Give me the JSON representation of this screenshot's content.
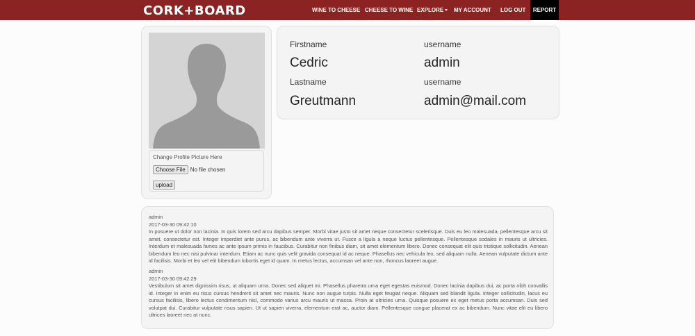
{
  "nav": {
    "brand": "CORK+BOARD",
    "links": [
      {
        "label": "WINE TO CHEESE"
      },
      {
        "label": "CHEESE TO WINE"
      },
      {
        "label": "EXPLORE"
      },
      {
        "label": "MY ACCOUNT"
      },
      {
        "label": "LOG OUT"
      },
      {
        "label": "REPORT"
      }
    ],
    "colors": {
      "bar": "#8a2322",
      "report_bg": "#000000"
    }
  },
  "profile": {
    "avatar_icon": "default-user-silhouette",
    "upload": {
      "hint": "Change Profile Picture Here",
      "choose_label": "Choose File",
      "file_status": "No file chosen",
      "upload_label": "upload"
    }
  },
  "info": {
    "firstname_label": "Firstname",
    "firstname_value": "Cedric",
    "username_label": "username",
    "username_value": "admin",
    "lastname_label": "Lastname",
    "lastname_value": "Greutmann",
    "email_label": "username",
    "email_value": "admin@mail.com"
  },
  "posts": [
    {
      "author": "admin",
      "timestamp": "2017-03-30 09:42:10",
      "body": "In posuere ut dolor non lacinia. In quis lorem sed arcu dapibus semper. Morbi vitae justo sit amet neque consectetur scelerisque. Duis eu leo malesuada, pellentesque arcu sit amet, consectetur est. Integer imperdiet ante purus, ac bibendum ante viverra ut. Fusce a ligula a neque luctus pellentesque. Pellentesque sodales in mauris ut ultricies. Interdum et malesuada fames ac ante ipsum primis in faucibus. Curabitur non finibus diam, sit amet elementum libero. Donec consequat elit quis tristique sollicitudin. Aenean bibendum leo nec nisi pulvinar interdum. Etiam ac nunc quis velit gravida consequat id ac neque. Phasellus nec vehicula leo, sed aliquam nulla. Aenean vulputate dictum ante id facilisis. Morbi et leo vel elit bibendum lobortis eget id quam. In metus lectus, accumsan vel ante non, rhoncus laoreet augue."
    },
    {
      "author": "admin",
      "timestamp": "2017-03-30 09:42:29",
      "body": "Vestibulum sit amet dignissim risus, ut aliquam urna. Donec sed aliquet mi. Phasellus pharetra urna eget egestas euismod. Donec lacinia dapibus dui, ac porta nibh convallis id. Integer in enim eu risus cursus hendrerit sit amet nec mauris. Nunc non augue turpis. Nulla eget feugiat neque. Aliquam sed blandit ligula. Integer sollicitudin, lacus eu cursus facilisis, libero lectus condimentum nisl, commodo varius arcu mauris ut massa. Proin at ultricies urna. Quisque posuere ex eget metus porta accumsan. Duis sed volutpat dui. Curabitur vulputate risus sapien. Ut ut sapien viverra, elementum erat ac, auctor diam. Pellentesque congue placerat ex ac bibendum. Nunc vitae elit eu libero ultrices laoreet nec at nunc."
    }
  ]
}
